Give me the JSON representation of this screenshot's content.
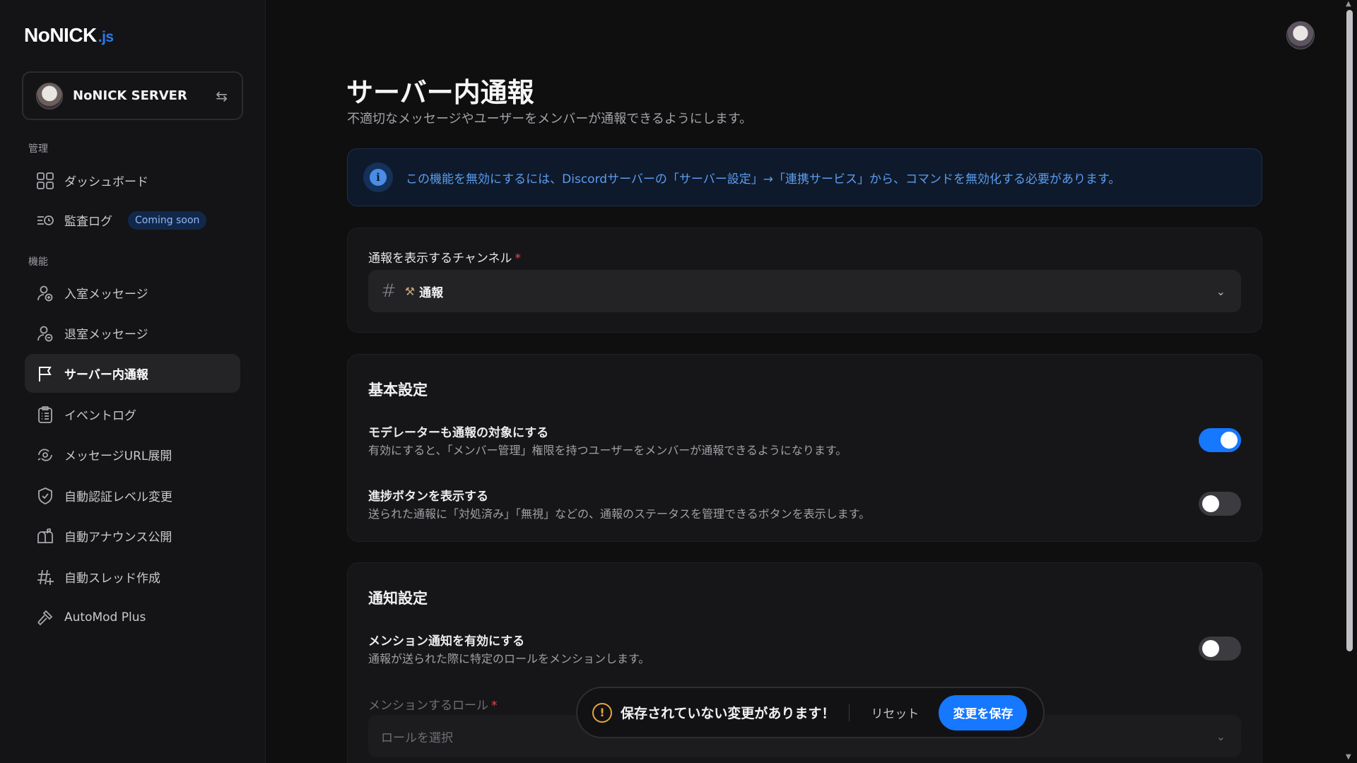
{
  "brand": {
    "name": "NoNICK",
    "suffix": ".js"
  },
  "server": {
    "name": "NoNICK SERVER"
  },
  "sidebar": {
    "section_manage": "管理",
    "section_features": "機能",
    "manage_items": [
      {
        "label": "ダッシュボード"
      },
      {
        "label": "監査ログ",
        "badge": "Coming soon"
      }
    ],
    "feature_items": [
      {
        "label": "入室メッセージ"
      },
      {
        "label": "退室メッセージ"
      },
      {
        "label": "サーバー内通報"
      },
      {
        "label": "イベントログ"
      },
      {
        "label": "メッセージURL展開"
      },
      {
        "label": "自動認証レベル変更"
      },
      {
        "label": "自動アナウンス公開"
      },
      {
        "label": "自動スレッド作成"
      },
      {
        "label": "AutoMod Plus"
      }
    ]
  },
  "page": {
    "title": "サーバー内通報",
    "description": "不適切なメッセージやユーザーをメンバーが通報できるようにします。",
    "info": "この機能を無効にするには、Discordサーバーの「サーバー設定」→「連携サービス」から、コマンドを無効化する必要があります。"
  },
  "channel_card": {
    "label": "通報を表示するチャンネル",
    "required_mark": "*",
    "selected_channel": "通報"
  },
  "basic_settings": {
    "title": "基本設定",
    "items": [
      {
        "title": "モデレーターも通報の対象にする",
        "desc": "有効にすると、「メンバー管理」権限を持つユーザーをメンバーが通報できるようになります。",
        "enabled": true
      },
      {
        "title": "進捗ボタンを表示する",
        "desc": "送られた通報に「対処済み」「無視」などの、通報のステータスを管理できるボタンを表示します。",
        "enabled": false
      }
    ]
  },
  "notify_settings": {
    "title": "通知設定",
    "mention_title": "メンション通知を有効にする",
    "mention_desc": "通報が送られた際に特定のロールをメンションします。",
    "mention_enabled": false,
    "role_label": "メンションするロール",
    "required_mark": "*",
    "role_placeholder": "ロールを選択"
  },
  "unsaved_bar": {
    "message": "保存されていない変更があります！",
    "reset_label": "リセット",
    "save_label": "変更を保存"
  },
  "colors": {
    "accent": "#1677ff",
    "info_text": "#5c9cf0",
    "warning": "#e8a43a"
  }
}
